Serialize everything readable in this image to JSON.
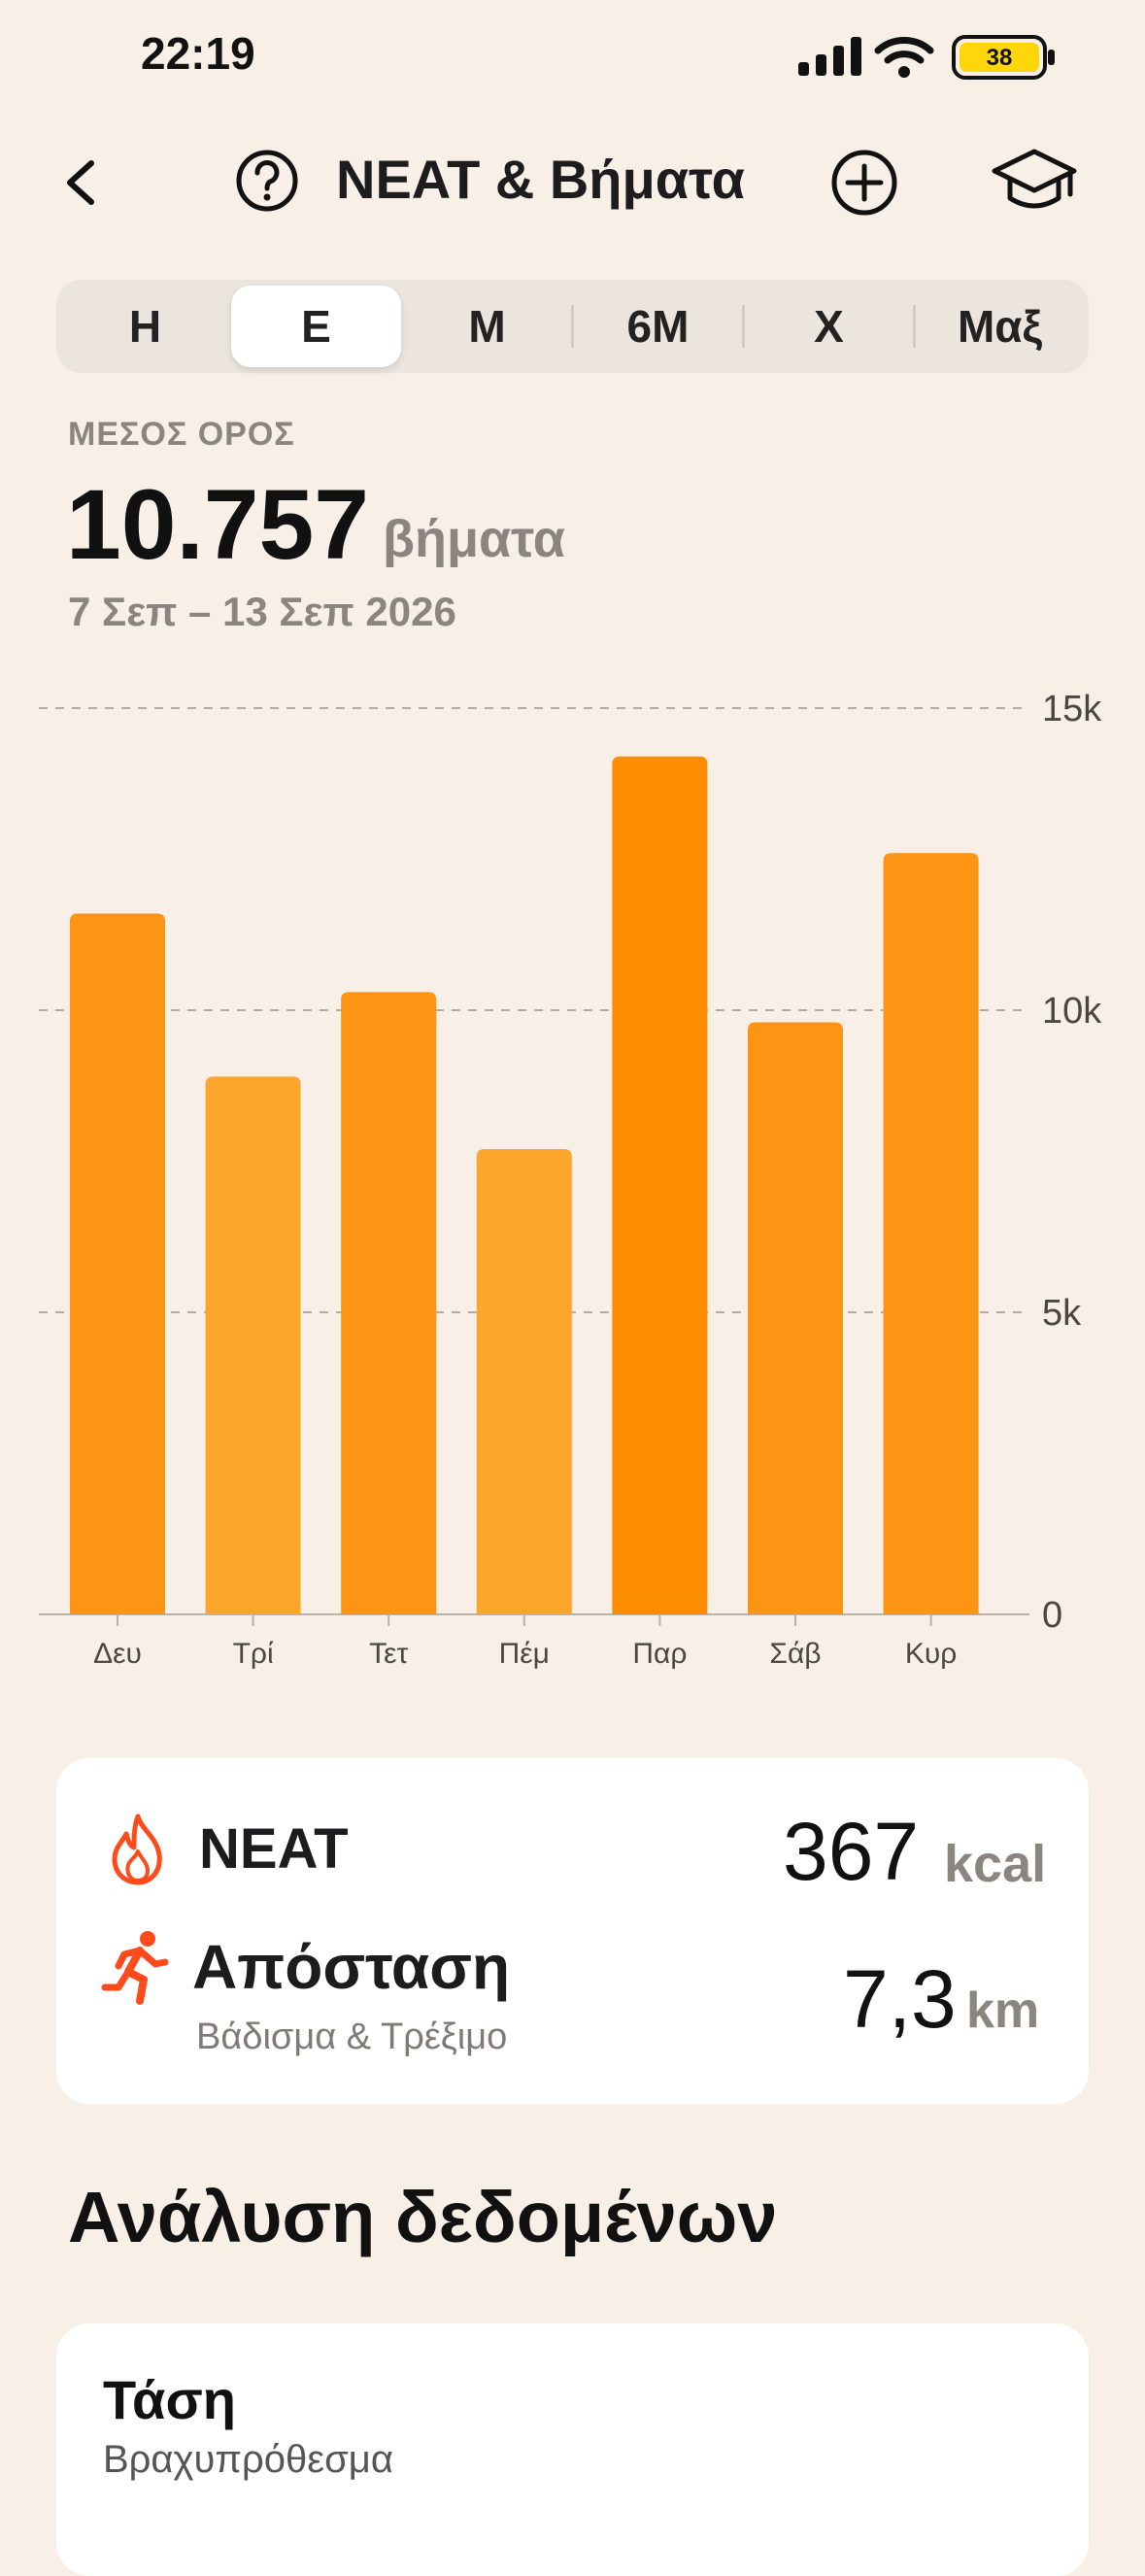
{
  "status": {
    "time": "22:19",
    "battery": "38"
  },
  "nav": {
    "title": "NEAT & Βήματα"
  },
  "tabs": [
    {
      "label": "Η"
    },
    {
      "label": "Ε"
    },
    {
      "label": "Μ"
    },
    {
      "label": "6Μ"
    },
    {
      "label": "Χ"
    },
    {
      "label": "Μαξ"
    }
  ],
  "active_tab": 1,
  "summary": {
    "label": "ΜΕΣΟΣ ΟΡΟΣ",
    "value": "10.757",
    "unit": "βήματα",
    "range": "7 Σεπ – 13 Σεπ 2026"
  },
  "chart_data": {
    "type": "bar",
    "categories": [
      "Δευ",
      "Τρί",
      "Τετ",
      "Πέμ",
      "Παρ",
      "Σάβ",
      "Κυρ"
    ],
    "values": [
      11600,
      8900,
      10300,
      7700,
      14200,
      9800,
      12600
    ],
    "ylim": [
      0,
      15000
    ],
    "yticks": [
      0,
      5000,
      10000,
      15000
    ],
    "ytick_labels": [
      "0",
      "5k",
      "10k",
      "15k"
    ],
    "grid": true,
    "colors": {
      "bar": "#fd9414",
      "bar_light": "#fca52c",
      "bar_dark": "#fc8c00"
    }
  },
  "stats": {
    "neat": {
      "label": "NEAT",
      "value": "367",
      "unit": "kcal"
    },
    "distance": {
      "label": "Απόσταση",
      "sublabel": "Βάδισμα & Τρέξιμο",
      "value": "7,3",
      "unit": "km"
    }
  },
  "analysis": {
    "title": "Ανάλυση δεδομένων",
    "trend": {
      "title": "Τάση",
      "subtitle": "Βραχυπρόθεσμα"
    }
  },
  "colors": {
    "accent": "#fd9414",
    "icon_red": "#ff4a1c",
    "background": "#f8efe6"
  }
}
